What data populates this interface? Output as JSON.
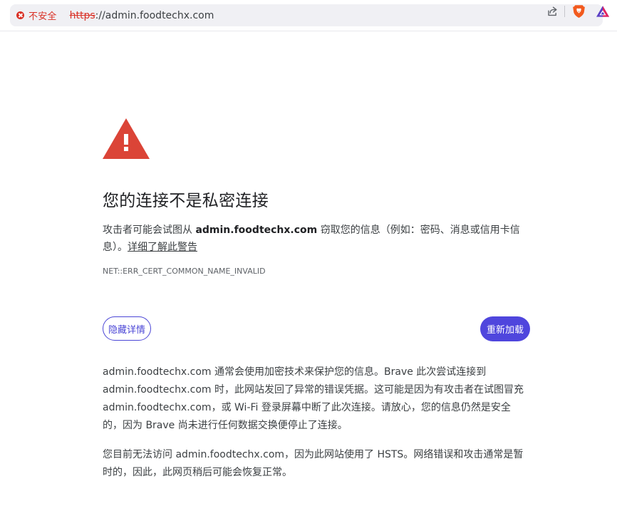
{
  "browser": {
    "security_label": "不安全",
    "url_scheme": "https",
    "url_rest": "://admin.foodtechx.com",
    "icons": [
      "share-icon",
      "brave-shield-icon",
      "brave-rewards-icon"
    ]
  },
  "interstitial": {
    "icon": "warning-triangle-icon",
    "title": "您的连接不是私密连接",
    "desc_prefix": "攻击者可能会试图从",
    "desc_domain": "admin.foodtechx.com",
    "desc_suffix": "窃取您的信息（例如：密码、消息或信用卡信息）。",
    "learn_more_link": "详细了解此警告",
    "error_code": "NET::ERR_CERT_COMMON_NAME_INVALID",
    "hide_details_button": "隐藏详情",
    "reload_button": "重新加载",
    "details_paragraph_1": "admin.foodtechx.com 通常会使用加密技术来保护您的信息。Brave 此次尝试连接到 admin.foodtechx.com 时，此网站发回了异常的错误凭据。这可能是因为有攻击者在试图冒充 admin.foodtechx.com，或 Wi-Fi 登录屏幕中断了此次连接。请放心，您的信息仍然是安全的，因为 Brave 尚未进行任何数据交换便停止了连接。",
    "details_paragraph_2": "您目前无法访问 admin.foodtechx.com，因为此网站使用了 HSTS。网络错误和攻击通常是暂时的，因此，此网页稍后可能会恢复正常。"
  },
  "colors": {
    "danger": "#d93025",
    "accent": "#4f46dd",
    "warning_triangle": "#db4437"
  }
}
